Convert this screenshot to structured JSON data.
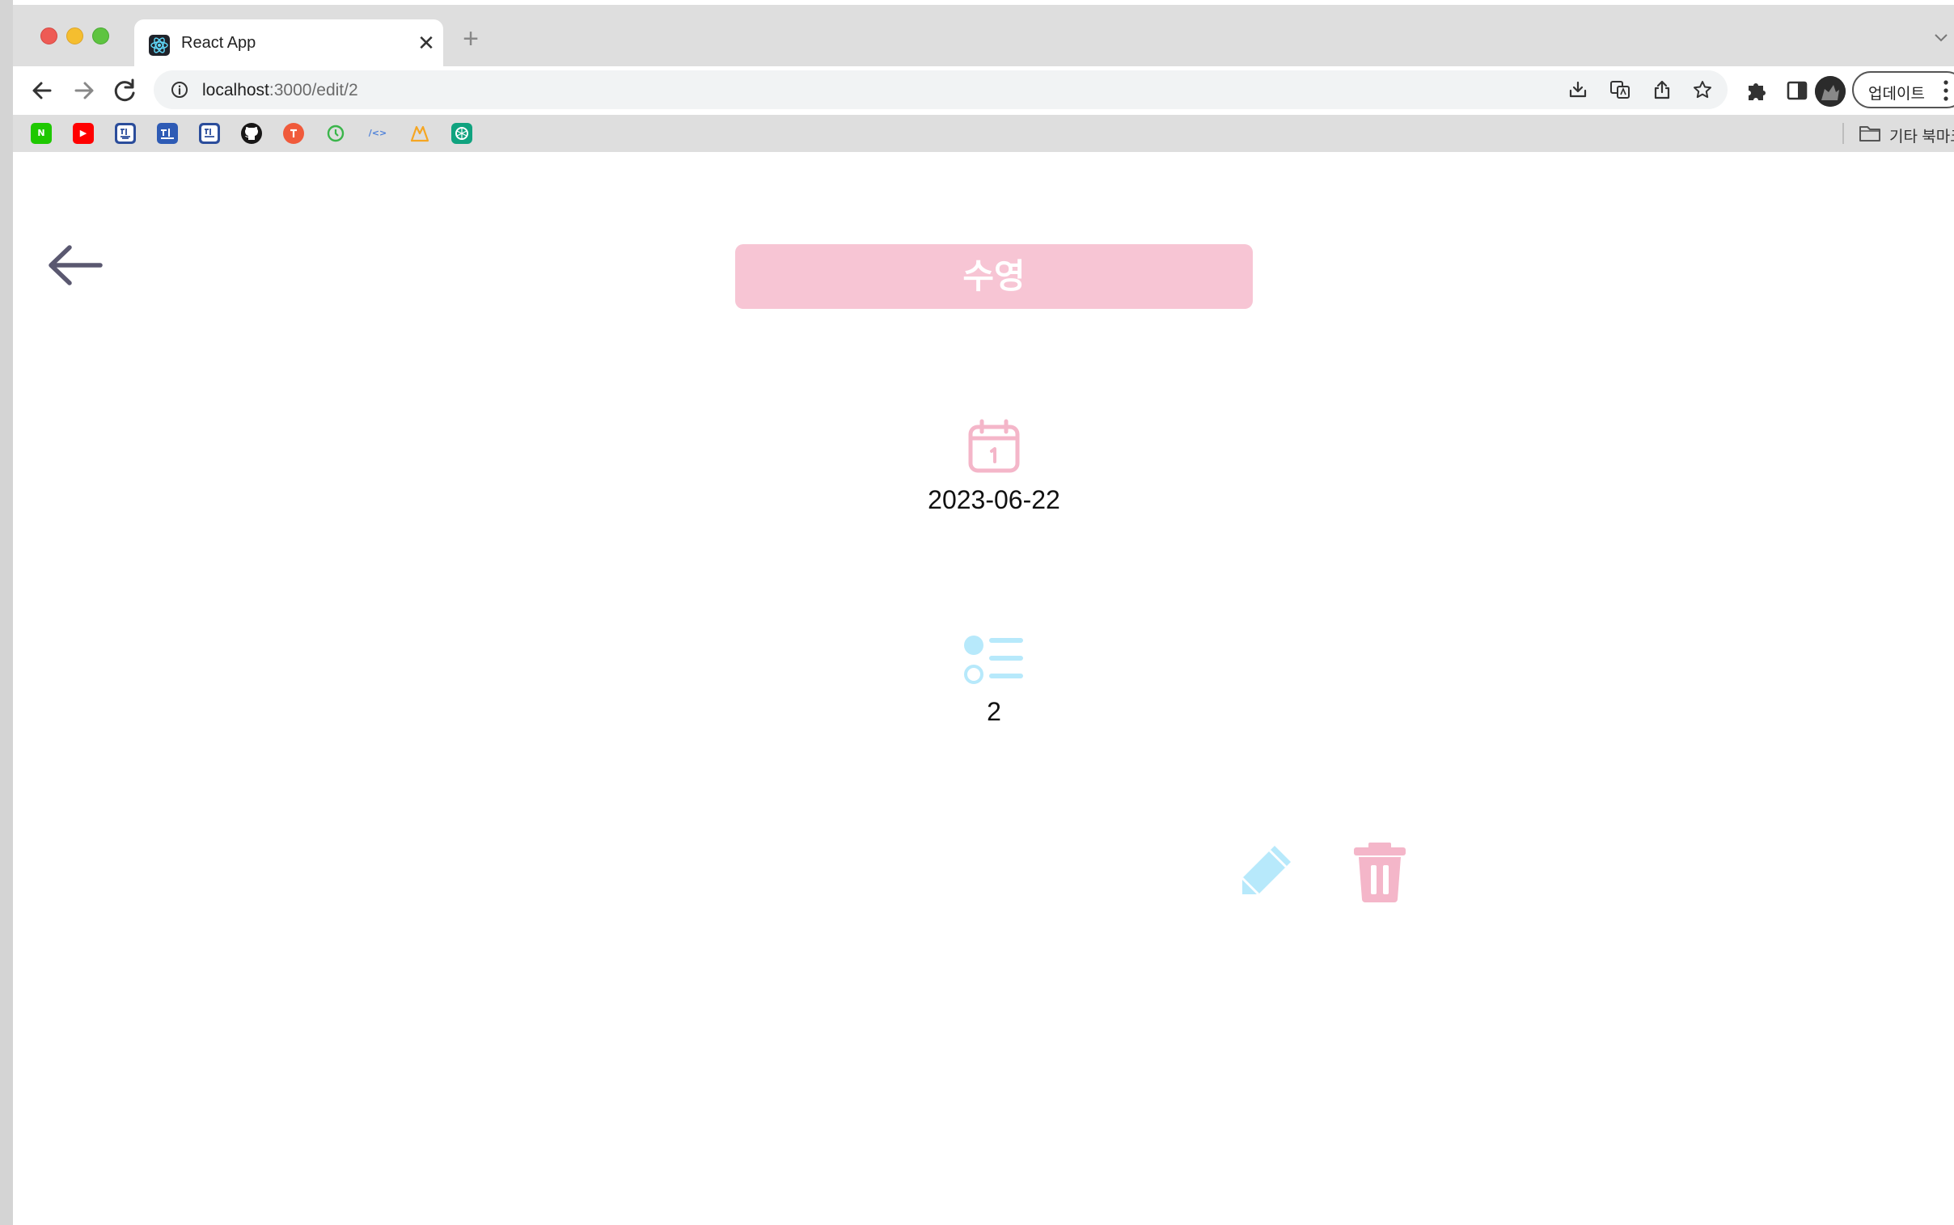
{
  "browser": {
    "tab": {
      "title": "React App",
      "favicon": "react-icon",
      "close_symbol": "✕"
    },
    "new_tab_symbol": "+",
    "address": {
      "host": "localhost",
      "path": ":3000/edit/2"
    },
    "update_button_label": "업데이트",
    "bookmarks": [
      {
        "name": "naver",
        "glyph": "N",
        "color": "#1ec800"
      },
      {
        "name": "youtube",
        "glyph": "▶",
        "color": "#ff0000"
      },
      {
        "name": "bookmark-kr-1",
        "glyph": "",
        "color": "#2b4d9b"
      },
      {
        "name": "bookmark-kr-2",
        "glyph": "",
        "color": "#2e5bb5"
      },
      {
        "name": "bookmark-kr-3",
        "glyph": "",
        "color": "#2b4d9b"
      },
      {
        "name": "github",
        "glyph": "",
        "color": "#181717"
      },
      {
        "name": "bookmark-orange",
        "glyph": "",
        "color": "#f05a3b"
      },
      {
        "name": "bookmark-green",
        "glyph": "",
        "color": "#3ab54a"
      },
      {
        "name": "bookmark-code",
        "glyph": "/<>",
        "color": "#4a7fd9"
      },
      {
        "name": "bookmark-triangle",
        "glyph": "",
        "color": "#f5a623"
      },
      {
        "name": "chatgpt",
        "glyph": "",
        "color": "#10a37f"
      }
    ],
    "other_bookmarks_label": "기타 북마크"
  },
  "page": {
    "title": "수영",
    "date": "2023-06-22",
    "count": "2",
    "colors": {
      "pink": "#f7c5d4",
      "pink_icon": "#f4b6c9",
      "blue_icon": "#b7e9fb",
      "arrow": "#5a5870"
    }
  }
}
